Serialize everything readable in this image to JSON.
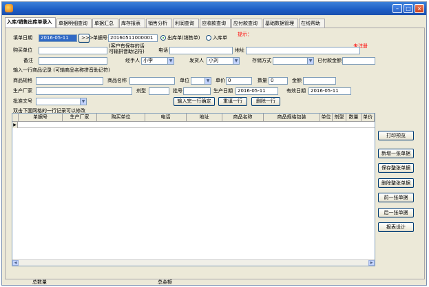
{
  "tabs": [
    {
      "label": "入库/销售出库单录入",
      "active": true
    },
    {
      "label": "单据明细查询",
      "active": false
    },
    {
      "label": "单据汇总",
      "active": false
    },
    {
      "label": "库存报表",
      "active": false
    },
    {
      "label": "销售分析",
      "active": false
    },
    {
      "label": "利润查询",
      "active": false
    },
    {
      "label": "应收款查询",
      "active": false
    },
    {
      "label": "应付款查询",
      "active": false
    },
    {
      "label": "基础数据管理",
      "active": false
    },
    {
      "label": "在线帮助",
      "active": false
    }
  ],
  "header_form": {
    "date_label": "填单日期",
    "date_value": "2016-05-11",
    "jump_button": ">>>",
    "doc_no_label": "单据号",
    "doc_no_value": "20160511000001",
    "radio_out_label": "出库单(销售单)",
    "radio_in_label": "入库单",
    "radio_selected": "out",
    "hint_prefix": "提示：",
    "unregistered": "未注册",
    "buyer_label": "购买单位",
    "buyer_value": "",
    "buyer_hint_line1": "(客户有保存的话",
    "buyer_hint_line2": "可输拼音助记符)",
    "phone_label": "电话",
    "phone_value": "",
    "address_label": "地址",
    "address_value": "",
    "remark_label": "备注",
    "remark_value": "",
    "handler_label": "经手人",
    "handler_value": "小李",
    "shipper_label": "发货人",
    "shipper_value": "小刘",
    "storage_label": "存储方式",
    "storage_value": "",
    "paid_label": "已付款金额",
    "paid_value": ""
  },
  "item_form": {
    "section_label": "输入一行商品记录 (可输商品名称拼音助记符)",
    "spec_label": "商品规格",
    "spec_value": "",
    "name_label": "商品名称",
    "name_value": "",
    "unit_label": "单位",
    "unit_value": "",
    "price_label": "单价",
    "price_value": "0",
    "qty_label": "数量",
    "qty_value": "0",
    "amount_label": "金额",
    "amount_value": "",
    "maker_label": "生产厂家",
    "maker_value": "",
    "form_label": "剂型",
    "form_value": "",
    "batch_label": "批号",
    "batch_value": "",
    "prod_date_label": "生产日期",
    "prod_date_value": "2016-05-11",
    "expiry_label": "有效日期",
    "expiry_value": "2016-05-11",
    "approval_label": "批准文号",
    "approval_value": "",
    "confirm_button": "输入完一行确定",
    "reset_button": "重填一行",
    "delete_button": "删除一行"
  },
  "grid": {
    "caption": "双击下面网格的一行记录可以修改",
    "columns": [
      "单据号",
      "生产厂家",
      "购买单位",
      "电话",
      "地址",
      "商品名称",
      "商品规格包装",
      "单位",
      "剂型",
      "数量",
      "单价"
    ]
  },
  "side_buttons": [
    "打印预览",
    "新增一张单据",
    "保存整张单据",
    "删除整张单据",
    "前一张单据",
    "后一张单据",
    "报表设计"
  ],
  "status": {
    "total_qty_label": "总数量",
    "total_amount_label": "总金额"
  }
}
